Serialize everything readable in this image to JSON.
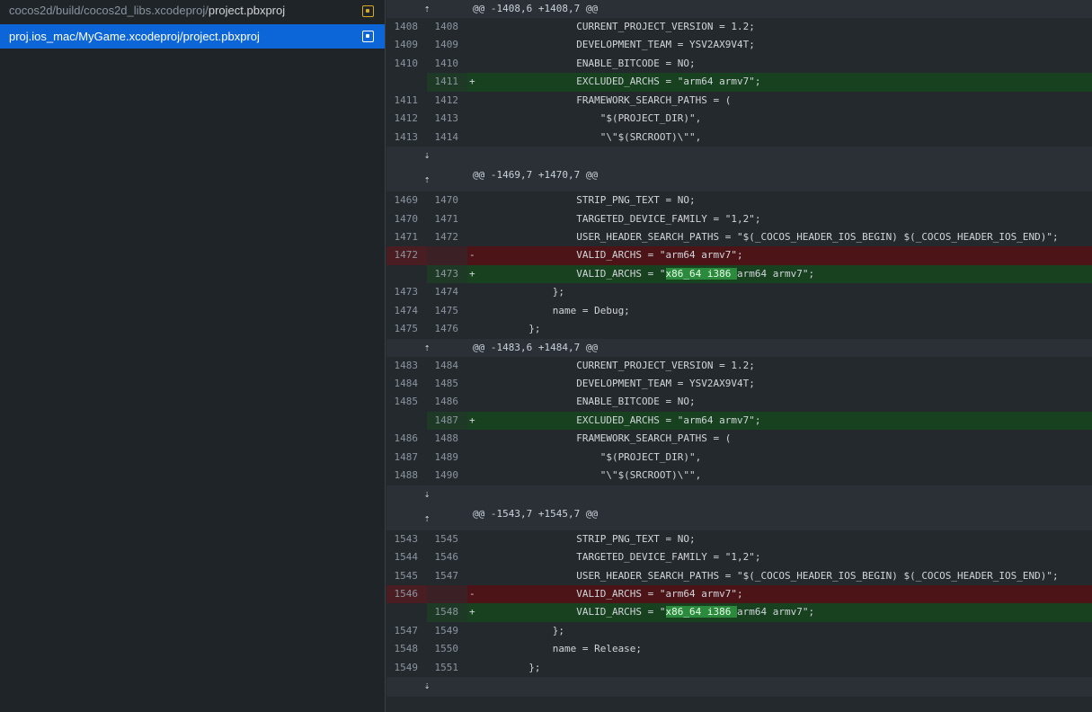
{
  "sidebar": {
    "files": [
      {
        "dir": "cocos2d/build/cocos2d_libs.xcodeproj/",
        "name": "project.pbxproj",
        "selected": false
      },
      {
        "dir": "proj.ios_mac/MyGame.xcodeproj/",
        "name": "project.pbxproj",
        "selected": true
      }
    ]
  },
  "diff": {
    "hunks": [
      {
        "header": "@@ -1408,6 +1408,7 @@",
        "lines": [
          {
            "type": "ctx",
            "old": "1408",
            "new": "1408",
            "text": "                CURRENT_PROJECT_VERSION = 1.2;"
          },
          {
            "type": "ctx",
            "old": "1409",
            "new": "1409",
            "text": "                DEVELOPMENT_TEAM = YSV2AX9V4T;"
          },
          {
            "type": "ctx",
            "old": "1410",
            "new": "1410",
            "text": "                ENABLE_BITCODE = NO;"
          },
          {
            "type": "add",
            "old": "",
            "new": "1411",
            "text": "                EXCLUDED_ARCHS = \"arm64 armv7\";"
          },
          {
            "type": "ctx",
            "old": "1411",
            "new": "1412",
            "text": "                FRAMEWORK_SEARCH_PATHS = ("
          },
          {
            "type": "ctx",
            "old": "1412",
            "new": "1413",
            "text": "                    \"$(PROJECT_DIR)\","
          },
          {
            "type": "ctx",
            "old": "1413",
            "new": "1414",
            "text": "                    \"\\\"$(SRCROOT)\\\"\","
          }
        ]
      },
      {
        "header": "@@ -1469,7 +1470,7 @@",
        "lines": [
          {
            "type": "ctx",
            "old": "1469",
            "new": "1470",
            "text": "                STRIP_PNG_TEXT = NO;"
          },
          {
            "type": "ctx",
            "old": "1470",
            "new": "1471",
            "text": "                TARGETED_DEVICE_FAMILY = \"1,2\";"
          },
          {
            "type": "ctx",
            "old": "1471",
            "new": "1472",
            "text": "                USER_HEADER_SEARCH_PATHS = \"$(_COCOS_HEADER_IOS_BEGIN) $(_COCOS_HEADER_IOS_END)\";"
          },
          {
            "type": "del",
            "old": "1472",
            "new": "",
            "text": "                VALID_ARCHS = \"arm64 armv7\";"
          },
          {
            "type": "add",
            "old": "",
            "new": "1473",
            "pre": "                VALID_ARCHS = \"",
            "hl": "x86_64 i386 ",
            "post": "arm64 armv7\";"
          },
          {
            "type": "ctx",
            "old": "1473",
            "new": "1474",
            "text": "            };"
          },
          {
            "type": "ctx",
            "old": "1474",
            "new": "1475",
            "text": "            name = Debug;"
          },
          {
            "type": "ctx",
            "old": "1475",
            "new": "1476",
            "text": "        };"
          }
        ]
      },
      {
        "header": "@@ -1483,6 +1484,7 @@",
        "lines": [
          {
            "type": "ctx",
            "old": "1483",
            "new": "1484",
            "text": "                CURRENT_PROJECT_VERSION = 1.2;"
          },
          {
            "type": "ctx",
            "old": "1484",
            "new": "1485",
            "text": "                DEVELOPMENT_TEAM = YSV2AX9V4T;"
          },
          {
            "type": "ctx",
            "old": "1485",
            "new": "1486",
            "text": "                ENABLE_BITCODE = NO;"
          },
          {
            "type": "add",
            "old": "",
            "new": "1487",
            "text": "                EXCLUDED_ARCHS = \"arm64 armv7\";"
          },
          {
            "type": "ctx",
            "old": "1486",
            "new": "1488",
            "text": "                FRAMEWORK_SEARCH_PATHS = ("
          },
          {
            "type": "ctx",
            "old": "1487",
            "new": "1489",
            "text": "                    \"$(PROJECT_DIR)\","
          },
          {
            "type": "ctx",
            "old": "1488",
            "new": "1490",
            "text": "                    \"\\\"$(SRCROOT)\\\"\","
          }
        ]
      },
      {
        "header": "@@ -1543,7 +1545,7 @@",
        "lines": [
          {
            "type": "ctx",
            "old": "1543",
            "new": "1545",
            "text": "                STRIP_PNG_TEXT = NO;"
          },
          {
            "type": "ctx",
            "old": "1544",
            "new": "1546",
            "text": "                TARGETED_DEVICE_FAMILY = \"1,2\";"
          },
          {
            "type": "ctx",
            "old": "1545",
            "new": "1547",
            "text": "                USER_HEADER_SEARCH_PATHS = \"$(_COCOS_HEADER_IOS_BEGIN) $(_COCOS_HEADER_IOS_END)\";"
          },
          {
            "type": "del",
            "old": "1546",
            "new": "",
            "text": "                VALID_ARCHS = \"arm64 armv7\";"
          },
          {
            "type": "add",
            "old": "",
            "new": "1548",
            "pre": "                VALID_ARCHS = \"",
            "hl": "x86_64 i386 ",
            "post": "arm64 armv7\";"
          },
          {
            "type": "ctx",
            "old": "1547",
            "new": "1549",
            "text": "            };"
          },
          {
            "type": "ctx",
            "old": "1548",
            "new": "1550",
            "text": "            name = Release;"
          },
          {
            "type": "ctx",
            "old": "1549",
            "new": "1551",
            "text": "        };"
          }
        ]
      }
    ],
    "icons": {
      "expand_up": "expand-up-icon",
      "expand_down": "expand-down-icon"
    }
  }
}
